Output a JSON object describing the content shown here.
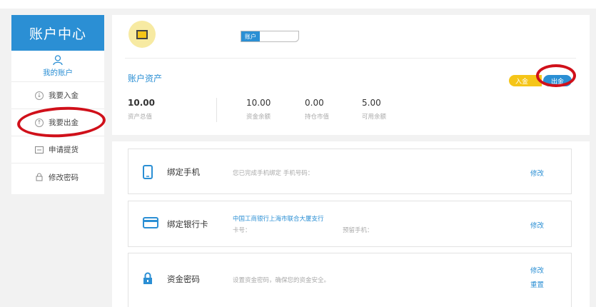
{
  "sidebar": {
    "title": "账户中心",
    "items": [
      {
        "label": "我的账户",
        "icon": "user-icon"
      },
      {
        "label": "我要入金",
        "icon": "arrow-down-circle-icon"
      },
      {
        "label": "我要出金",
        "icon": "arrow-up-circle-icon"
      },
      {
        "label": "申请提货",
        "icon": "document-icon"
      },
      {
        "label": "修改密码",
        "icon": "lock-icon"
      }
    ]
  },
  "account": {
    "tag_label": "账户"
  },
  "assets": {
    "title": "账户资产",
    "deposit_label": "入金",
    "withdraw_label": "出金",
    "total": {
      "value": "10.00",
      "label": "资产总值"
    },
    "balance": {
      "value": "10.00",
      "label": "资金余额"
    },
    "position": {
      "value": "0.00",
      "label": "持仓市值"
    },
    "available": {
      "value": "5.00",
      "label": "可用余额"
    }
  },
  "cards": {
    "phone": {
      "title": "绑定手机",
      "desc": "您已完成手机绑定 手机号码：",
      "link": "修改"
    },
    "bank": {
      "title": "绑定银行卡",
      "bank_name": "中国工商银行上海市联合大厦支行",
      "card_no_label": "卡号：",
      "reserved_phone_label": "预留手机：",
      "link": "修改"
    },
    "password": {
      "title": "资金密码",
      "desc": "设置资金密码，确保您的资金安全。",
      "link_modify": "修改",
      "link_reset": "重置"
    }
  },
  "colors": {
    "accent": "#2b8fd4",
    "gold": "#f5c518",
    "highlight_ring": "#d0101a"
  }
}
